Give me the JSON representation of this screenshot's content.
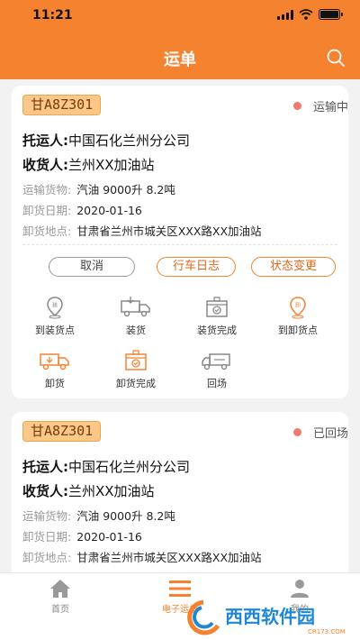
{
  "status_bar": {
    "time": "11:21"
  },
  "header": {
    "title": "运单",
    "search_icon": "search-icon"
  },
  "colors": {
    "primary": "#f5822f",
    "status_dot": "#f07a6b",
    "plate_bg": "#fbc889"
  },
  "orders": [
    {
      "plate": "甘A8Z301",
      "status": "运输中",
      "shipper_label": "托运人:",
      "shipper": "中国石化兰州分公司",
      "receiver_label": "收货人:",
      "receiver": "兰州XX加油站",
      "cargo_label": "运输货物:",
      "cargo": "汽油 9000升 8.2吨",
      "date_label": "卸货日期:",
      "date": "2020-01-16",
      "address_label": "卸货地点:",
      "address": "甘肃省兰州市城关区XXX路XX加油站",
      "actions": {
        "cancel": "取消",
        "log": "行车日志",
        "change_state": "状态变更"
      },
      "steps": [
        {
          "label": "到装货点",
          "icon": "pin-load-icon"
        },
        {
          "label": "装货",
          "icon": "truck-load-icon"
        },
        {
          "label": "装货完成",
          "icon": "box-check-icon"
        },
        {
          "label": "到卸货点",
          "icon": "pin-unload-icon"
        },
        {
          "label": "卸货",
          "icon": "truck-unload-icon"
        },
        {
          "label": "卸货完成",
          "icon": "box-done-icon"
        },
        {
          "label": "回场",
          "icon": "truck-return-icon"
        }
      ]
    },
    {
      "plate": "甘A8Z301",
      "status": "已回场",
      "shipper_label": "托运人:",
      "shipper": "中国石化兰州分公司",
      "receiver_label": "收货人:",
      "receiver": "兰州XX加油站",
      "cargo_label": "运输货物:",
      "cargo": "汽油 9000升 8.2吨",
      "date_label": "卸货日期:",
      "date": "2020-01-16",
      "address_label": "卸货地点:",
      "address": "甘肃省兰州市城关区XXX路XX加油站"
    }
  ],
  "tabbar": [
    {
      "label": "首页",
      "icon": "home-icon",
      "active": false
    },
    {
      "label": "电子运单",
      "icon": "list-icon",
      "active": true
    },
    {
      "label": "我的",
      "icon": "user-icon",
      "active": false
    }
  ],
  "watermark": {
    "text": "西西软件园",
    "sub": "CR173.COM"
  }
}
